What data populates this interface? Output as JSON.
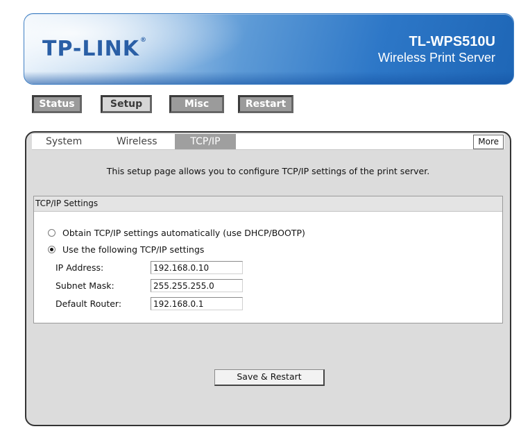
{
  "header": {
    "logo": "TP-LINK",
    "logo_mark": "®",
    "model": "TL-WPS510U",
    "product": "Wireless Print Server"
  },
  "nav": {
    "items": [
      {
        "label": "Status"
      },
      {
        "label": "Setup"
      },
      {
        "label": "Misc"
      },
      {
        "label": "Restart"
      }
    ],
    "active": "Setup"
  },
  "tabs": {
    "items": [
      {
        "label": "System"
      },
      {
        "label": "Wireless"
      },
      {
        "label": "TCP/IP"
      }
    ],
    "active": "TCP/IP",
    "more_label": "More"
  },
  "intro": "This setup page allows you to configure TCP/IP settings of the print server.",
  "settings": {
    "title": "TCP/IP Settings",
    "options": [
      {
        "label": "Obtain TCP/IP settings automatically (use DHCP/BOOTP)",
        "checked": false
      },
      {
        "label": "Use the following TCP/IP settings",
        "checked": true
      }
    ],
    "fields": [
      {
        "label": "IP Address:",
        "value": "192.168.0.10"
      },
      {
        "label": "Subnet Mask:",
        "value": "255.255.255.0"
      },
      {
        "label": "Default Router:",
        "value": "192.168.0.1"
      }
    ]
  },
  "save_label": "Save & Restart"
}
